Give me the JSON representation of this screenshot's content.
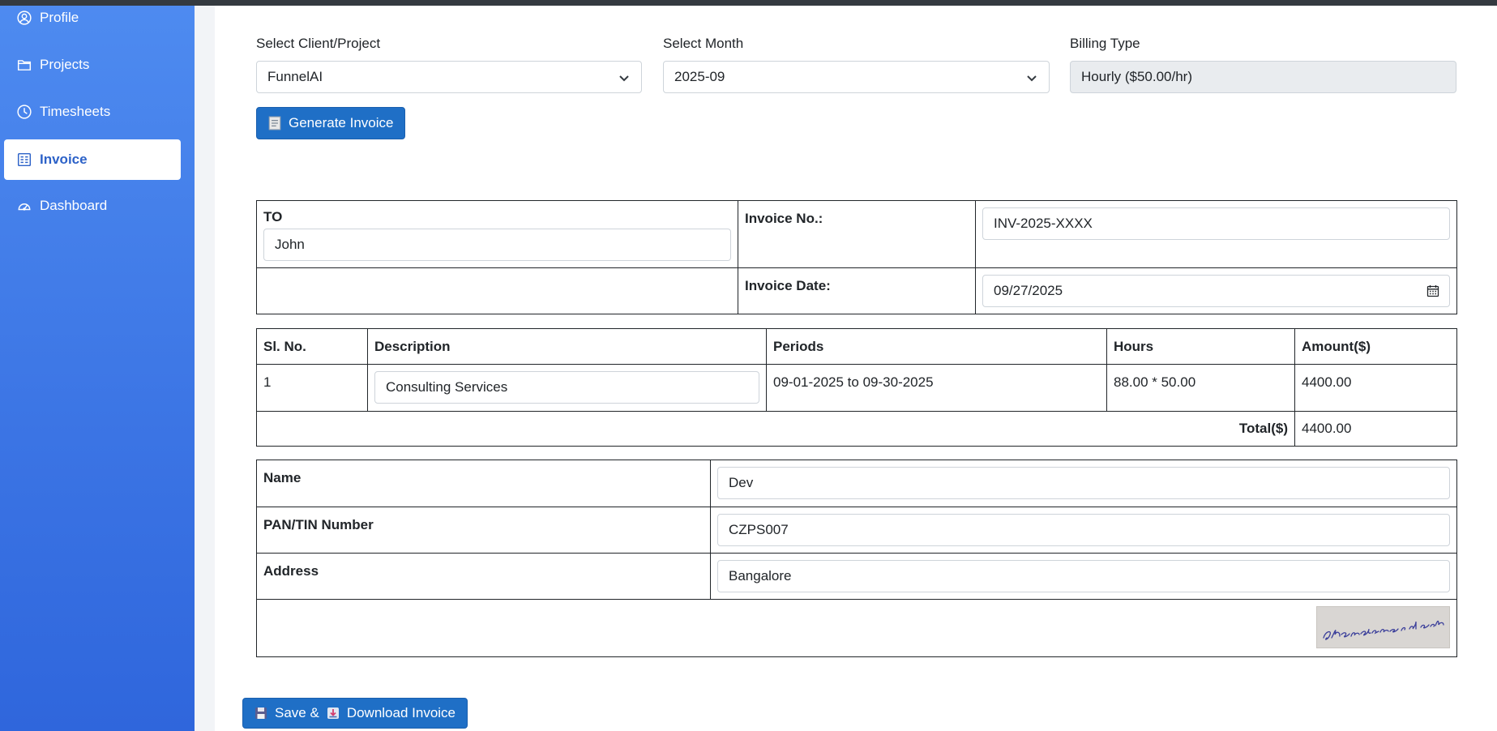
{
  "sidebar": {
    "items": [
      {
        "label": "Profile",
        "icon": "user-circle-icon"
      },
      {
        "label": "Projects",
        "icon": "folder-icon"
      },
      {
        "label": "Timesheets",
        "icon": "clock-icon"
      },
      {
        "label": "Invoice",
        "icon": "invoice-icon",
        "active": true
      },
      {
        "label": "Dashboard",
        "icon": "speedometer-icon"
      }
    ]
  },
  "filters": {
    "client_label": "Select Client/Project",
    "client_value": "FunnelAI",
    "month_label": "Select Month",
    "month_value": "2025-09",
    "billing_label": "Billing Type",
    "billing_value": "Hourly ($50.00/hr)"
  },
  "generate_button": "Generate Invoice",
  "invoice_header": {
    "to_label": "TO",
    "to_value": "John",
    "invoice_no_label": "Invoice No.:",
    "invoice_no_value": "INV-2025-XXXX",
    "invoice_date_label": "Invoice Date:",
    "invoice_date_value": "09/27/2025"
  },
  "items_table": {
    "headers": [
      "Sl. No.",
      "Description",
      "Periods",
      "Hours",
      "Amount($)"
    ],
    "rows": [
      {
        "sl": "1",
        "description": "Consulting Services",
        "period": "09-01-2025 to 09-30-2025",
        "hours": "88.00 * 50.00",
        "amount": "4400.00"
      }
    ],
    "total_label": "Total($)",
    "total_value": "4400.00"
  },
  "payee": {
    "name_label": "Name",
    "name_value": "Dev",
    "pan_label": "PAN/TIN Number",
    "pan_value": "CZPS007",
    "address_label": "Address",
    "address_value": "Bangalore",
    "signature_text": "Chandrasekar rd sah"
  },
  "save_button": {
    "save_label": "Save &",
    "download_label": "Download Invoice"
  },
  "colors": {
    "primary": "#1f6fc6",
    "sidebar_top": "#4e8bf0",
    "sidebar_bottom": "#2f66dc",
    "active_text": "#2d62c8"
  }
}
